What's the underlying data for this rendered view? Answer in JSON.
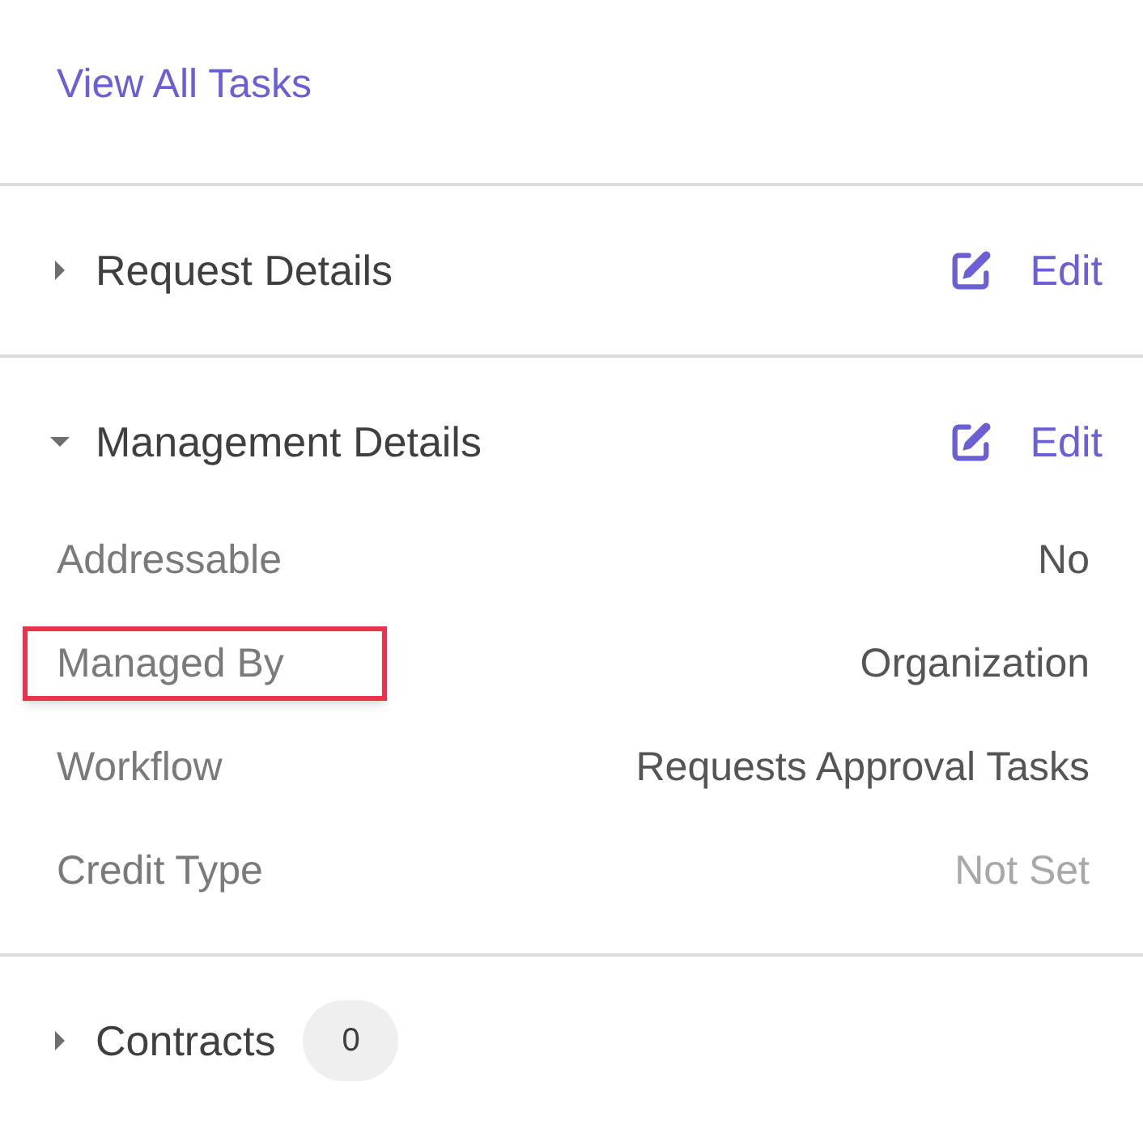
{
  "link": {
    "label": "View All Tasks"
  },
  "sections": [
    {
      "title": "Request Details",
      "expanded": false,
      "edit_label": "Edit"
    },
    {
      "title": "Management Details",
      "expanded": true,
      "edit_label": "Edit",
      "fields": [
        {
          "label": "Addressable",
          "value": "No",
          "highlighted": false,
          "value_set": true
        },
        {
          "label": "Managed By",
          "value": "Organization",
          "highlighted": true,
          "value_set": true
        },
        {
          "label": "Workflow",
          "value": "Requests Approval Tasks",
          "highlighted": false,
          "value_set": true
        },
        {
          "label": "Credit Type",
          "value": "Not Set",
          "highlighted": false,
          "value_set": false
        }
      ]
    },
    {
      "title": "Contracts",
      "expanded": false,
      "count": "0"
    }
  ]
}
